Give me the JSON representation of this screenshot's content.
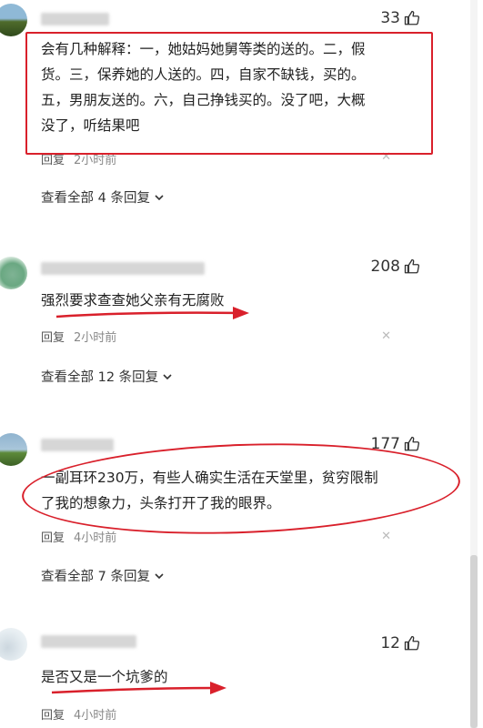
{
  "comments": [
    {
      "likes": "33",
      "text_lines": [
        "会有几种解释：一，她姑妈她舅等类的送的。二，假",
        "货。三，保养她的人送的。四，自家不缺钱，买的。",
        "五，男朋友送的。六，自己挣钱买的。没了吧，大概",
        "没了，听结果吧"
      ],
      "reply_label": "回复",
      "time": "2小时前",
      "more_label": "查看全部 4 条回复"
    },
    {
      "likes": "208",
      "text_lines": [
        "强烈要求查查她父亲有无腐败"
      ],
      "reply_label": "回复",
      "time": "2小时前",
      "more_label": "查看全部 12 条回复"
    },
    {
      "likes": "177",
      "text_lines": [
        "一副耳环230万，有些人确实生活在天堂里，贫穷限制",
        "了我的想象力，头条打开了我的眼界。"
      ],
      "reply_label": "回复",
      "time": "4小时前",
      "more_label": "查看全部 7 条回复"
    },
    {
      "likes": "12",
      "text_lines": [
        "是否又是一个坑爹的"
      ],
      "reply_label": "回复",
      "time": "4小时前"
    }
  ],
  "icons": {
    "like": "thumbs-up-icon",
    "chevron": "chevron-down-icon",
    "close": "close-icon"
  },
  "colors": {
    "annotation_red": "#d9202b"
  }
}
